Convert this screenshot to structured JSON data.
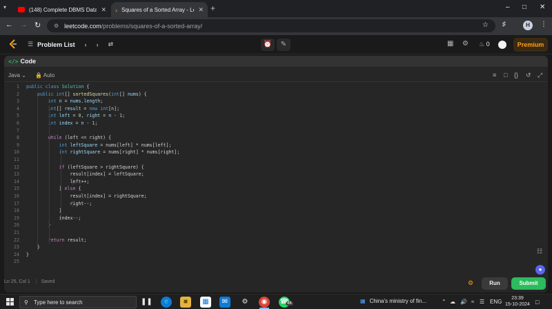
{
  "browser": {
    "tabs": [
      {
        "title": "(148) Complete DBMS Data Ba",
        "favicon": "youtube-icon",
        "color": "#ff0000",
        "active": false
      },
      {
        "title": "Squares of a Sorted Array - Lee",
        "favicon": "leetcode-icon",
        "color": "#ffa116",
        "active": true
      }
    ],
    "url_host": "leetcode.com",
    "url_path": "/problems/squares-of-a-sorted-array/",
    "profile_initial": "H"
  },
  "header": {
    "problem_list_label": "Problem List",
    "streak_count": "0",
    "premium_label": "Premium",
    "accent_color": "#ffa116"
  },
  "panel": {
    "title": "Code",
    "language": "Java",
    "mode": "Auto"
  },
  "editor": {
    "lines": [
      {
        "n": "1",
        "html": "<span class=\"kw\">public class</span> <span class=\"ty\">Solution</span> {"
      },
      {
        "n": "2",
        "html": "    <span class=\"kw\">public int</span>[] <span class=\"fn\">sortedSquares</span>(<span class=\"kw\">int</span>[] <span class=\"vr\">nums</span>) {"
      },
      {
        "n": "3",
        "html": "        <span class=\"kw\">int</span> <span class=\"vr\">n</span> = <span class=\"vr\">nums</span>.<span class=\"vr\">length</span>;"
      },
      {
        "n": "4",
        "html": "        <span class=\"kw\">int</span>[] <span class=\"vr\">result</span> = <span class=\"kw\">new int</span>[<span class=\"vr\">n</span>];"
      },
      {
        "n": "5",
        "html": "        <span class=\"kw\">int</span> <span class=\"vr\">left</span> = <span class=\"nm\">0</span>, <span class=\"vr\">right</span> = <span class=\"vr\">n</span> - <span class=\"nm\">1</span>;"
      },
      {
        "n": "6",
        "html": "        <span class=\"kw\">int</span> <span class=\"vr\">index</span> = <span class=\"vr\">n</span> - <span class=\"nm\">1</span>;"
      },
      {
        "n": "7",
        "html": ""
      },
      {
        "n": "8",
        "html": "        <span class=\"ctl\">while</span> (left &lt;= right) {"
      },
      {
        "n": "9",
        "html": "            <span class=\"kw\">int</span> <span class=\"vr\">leftSquare</span> = nums[left] * nums[left];"
      },
      {
        "n": "10",
        "html": "            <span class=\"kw\">int</span> <span class=\"vr\">rightSquare</span> = nums[right] * nums[right];"
      },
      {
        "n": "11",
        "html": ""
      },
      {
        "n": "12",
        "html": "            <span class=\"ctl\">if</span> (leftSquare &gt; rightSquare) {"
      },
      {
        "n": "13",
        "html": "                result[index] = leftSquare;"
      },
      {
        "n": "14",
        "html": "                left++;"
      },
      {
        "n": "15",
        "html": "            } <span class=\"ctl\">else</span> {"
      },
      {
        "n": "16",
        "html": "                result[index] = rightSquare;"
      },
      {
        "n": "17",
        "html": "                right--;"
      },
      {
        "n": "18",
        "html": "            }"
      },
      {
        "n": "19",
        "html": "            index--;"
      },
      {
        "n": "20",
        "html": "        }"
      },
      {
        "n": "21",
        "html": ""
      },
      {
        "n": "22",
        "html": "        <span class=\"ctl\">return</span> result;"
      },
      {
        "n": "23",
        "html": "    }"
      },
      {
        "n": "24",
        "html": "}"
      },
      {
        "n": "25",
        "html": ""
      }
    ]
  },
  "status": {
    "cursor": "Ln 25, Col 1",
    "saved": "Saved"
  },
  "actions": {
    "run_label": "Run",
    "submit_label": "Submit",
    "submit_color": "#2cbb5d"
  },
  "taskbar": {
    "search_placeholder": "Type here to search",
    "news": "China's ministry of fin...",
    "lang": "ENG",
    "time": "23:39",
    "date": "15-10-2024",
    "whatsapp_badge": "44"
  }
}
